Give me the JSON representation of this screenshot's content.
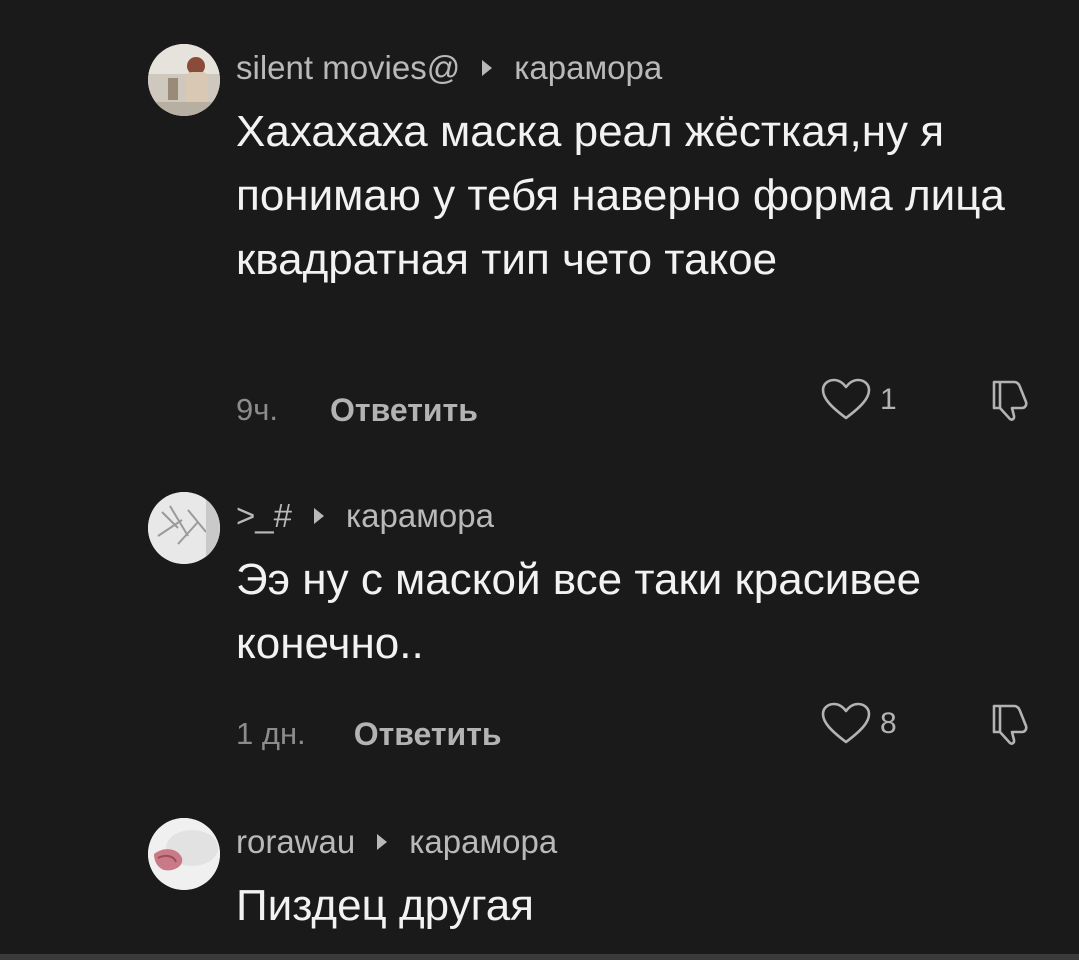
{
  "comments": [
    {
      "username": "silent movies@",
      "reply_to": "карамора",
      "text": "Хахахаха маска реал жёсткая,ну я понимаю у тебя наверно форма лица квадратная тип чето такое",
      "time": "9ч.",
      "reply_label": "Ответить",
      "likes": "1"
    },
    {
      "username": ">_#",
      "reply_to": "карамора",
      "text": "Ээ ну с маской все таки красивее конечно..",
      "time": "1 дн.",
      "reply_label": "Ответить",
      "likes": "8"
    },
    {
      "username": "rorawau",
      "reply_to": "карамора",
      "text": "Пиздец другая"
    }
  ],
  "icons": {
    "like": "heart-outline-icon",
    "dislike": "thumbs-down-outline-icon",
    "reply_arrow": "triangle-right-icon"
  },
  "colors": {
    "background": "#1a1a1a",
    "text": "#f2f2f2",
    "secondary": "#b9b9b9",
    "muted": "#8c8c8c"
  }
}
